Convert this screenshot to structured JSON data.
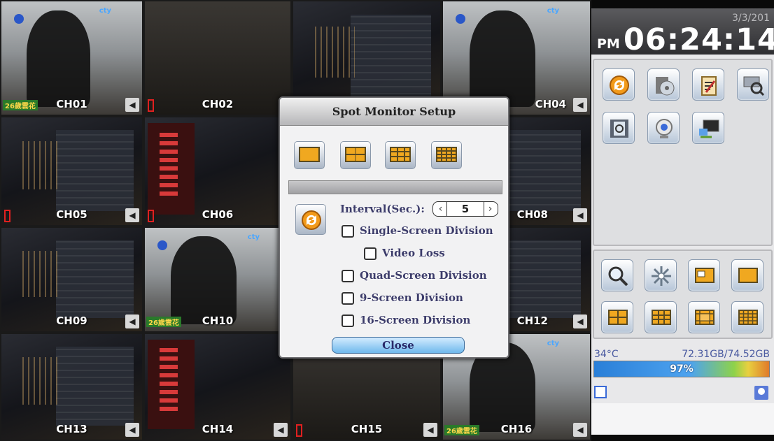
{
  "channels": [
    {
      "label": "CH01",
      "scene": "office-person",
      "ticker": "26歲雲花"
    },
    {
      "label": "CH02",
      "scene": "dark"
    },
    {
      "label": "",
      "scene": "night"
    },
    {
      "label": "CH04",
      "scene": "office-person"
    },
    {
      "label": "CH05",
      "scene": "night"
    },
    {
      "label": "CH06",
      "scene": "red-night"
    },
    {
      "label": "",
      "scene": "night"
    },
    {
      "label": "CH08",
      "scene": "night"
    },
    {
      "label": "CH09",
      "scene": "night"
    },
    {
      "label": "CH10",
      "scene": "office-person",
      "ticker": "26歲雲花"
    },
    {
      "label": "",
      "scene": "night"
    },
    {
      "label": "CH12",
      "scene": "night"
    },
    {
      "label": "CH13",
      "scene": "night"
    },
    {
      "label": "CH14",
      "scene": "red-night"
    },
    {
      "label": "CH15",
      "scene": "dark"
    },
    {
      "label": "CH16",
      "scene": "office-person",
      "ticker": "26歲雲花"
    }
  ],
  "status": {
    "date": "3/3/201",
    "ampm": "PM",
    "time": "06:24:14",
    "temperature": "34°C",
    "disk": "72.31GB/74.52GB",
    "disk_usage_percent_label": "97%",
    "disk_usage_fraction": 0.97
  },
  "dialog": {
    "title": "Spot Monitor Setup",
    "interval_label": "Interval(Sec.):",
    "interval_value": "5",
    "options": {
      "single": "Single-Screen Division",
      "video_loss": "Video Loss",
      "quad": "Quad-Screen Division",
      "nine": "9-Screen Division",
      "sixteen": "16-Screen Division"
    },
    "close_label": "Close"
  },
  "icons": {
    "menu": [
      "sync-icon",
      "disc-icon",
      "clipboard-icon",
      "search-film-icon",
      "film-search-icon",
      "webcam-icon",
      "monitor-icon"
    ],
    "controls": [
      "magnifier-icon",
      "freeze-icon",
      "pip-icon",
      "single-screen-icon",
      "quad-screen-icon",
      "nine-screen-icon",
      "thirteen-screen-icon",
      "sixteen-screen-icon"
    ]
  },
  "colors": {
    "accent": "#f0a820",
    "panel": "#e8e8ea",
    "dialog_text": "#3c3c6a"
  }
}
